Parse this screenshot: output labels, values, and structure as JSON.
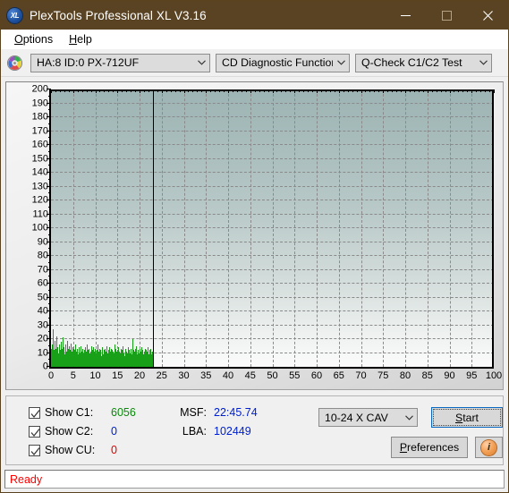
{
  "window": {
    "title": "PlexTools Professional XL V3.16",
    "app_icon": "xl-logo-icon",
    "icon_text": "XL",
    "minimize": "minimize-icon",
    "maximize": "maximize-icon",
    "close": "close-icon",
    "titlebar_color": "#5a4322"
  },
  "menubar": {
    "items": [
      {
        "label": "Options",
        "accel": "O"
      },
      {
        "label": "Help",
        "accel": "H"
      }
    ]
  },
  "toolbar": {
    "disc_icon": "compact-disc-icon",
    "device": {
      "value": "HA:8 ID:0  PX-712UF"
    },
    "function": {
      "value": "CD Diagnostic Functions"
    },
    "test": {
      "value": "Q-Check C1/C2 Test"
    }
  },
  "chart_data": {
    "type": "bar",
    "title": "",
    "xlabel": "",
    "ylabel": "",
    "xlim": [
      0,
      100
    ],
    "ylim": [
      0,
      200
    ],
    "xticks": [
      0,
      5,
      10,
      15,
      20,
      25,
      30,
      35,
      40,
      45,
      50,
      55,
      60,
      65,
      70,
      75,
      80,
      85,
      90,
      95,
      100
    ],
    "yticks": [
      0,
      10,
      20,
      30,
      40,
      50,
      60,
      70,
      80,
      90,
      100,
      110,
      120,
      130,
      140,
      150,
      160,
      170,
      180,
      190,
      200
    ],
    "grid": true,
    "legend": null,
    "series": [
      {
        "name": "C1",
        "color": "#19a019",
        "x_start": 0,
        "x_end": 23,
        "values": [
          13,
          8,
          11,
          16,
          9,
          27,
          7,
          12,
          10,
          6,
          19,
          8,
          13,
          7,
          22,
          9,
          5,
          11,
          14,
          7,
          10,
          16,
          8,
          6,
          12,
          9,
          18,
          7,
          11,
          5,
          13,
          8,
          21,
          10,
          6,
          14,
          9,
          7,
          12,
          16,
          8,
          11,
          6,
          19,
          9,
          7,
          13,
          10,
          5,
          15,
          8,
          12,
          7,
          17,
          9,
          6,
          11,
          14,
          8,
          10,
          5,
          13,
          7,
          9,
          12,
          6,
          16,
          8,
          11,
          7,
          10,
          13,
          5,
          9,
          14,
          7,
          12,
          6,
          10,
          8,
          15,
          9,
          7,
          11,
          5,
          13,
          8,
          10,
          6,
          12,
          9,
          7,
          14,
          8,
          11,
          5,
          10,
          16,
          7,
          9,
          12,
          6,
          13,
          8,
          10,
          7,
          11,
          5,
          15,
          9,
          8,
          12,
          6,
          10,
          14,
          7,
          9,
          11,
          5,
          13,
          8,
          10,
          7,
          12,
          6,
          16,
          9,
          8,
          11,
          7,
          10,
          5,
          13,
          9,
          12,
          6,
          8,
          14,
          7,
          11,
          9,
          5,
          10,
          12,
          8,
          7,
          13,
          6,
          9,
          11,
          15,
          8,
          10,
          7,
          12,
          5,
          9,
          14,
          8,
          11,
          6,
          10,
          7,
          13,
          9,
          8,
          12,
          5,
          11,
          7,
          10,
          16,
          9,
          6,
          13,
          8,
          11,
          7,
          10,
          12,
          5,
          9,
          14,
          8,
          7,
          11,
          6,
          10,
          13,
          9,
          8,
          12,
          7,
          5,
          11,
          15,
          9,
          10,
          6,
          8,
          13,
          7,
          12,
          9,
          11,
          5,
          10,
          8,
          14,
          7,
          9,
          6,
          12,
          10,
          8,
          11,
          13,
          7,
          9,
          5,
          20,
          10,
          8,
          12,
          6,
          11,
          9,
          7,
          13,
          10,
          8,
          15,
          9,
          6,
          11,
          7,
          12,
          10,
          8,
          5,
          13,
          9,
          11,
          7,
          10,
          6,
          14,
          8,
          12,
          9,
          7,
          11,
          5,
          10,
          13,
          8,
          9,
          12,
          6,
          7,
          11,
          10,
          8,
          14,
          9,
          5,
          12,
          7,
          10,
          6,
          13,
          9,
          8,
          11,
          7,
          10,
          12
        ]
      }
    ],
    "marker": {
      "name": "position-marker",
      "x": 23,
      "color": "#000000"
    },
    "plot_bg_top": "#9db4b4",
    "plot_bg_bottom": "#fbfbfb"
  },
  "info": {
    "checkboxes": [
      {
        "name": "show-c1",
        "label": "Show C1:",
        "checked": true,
        "value": "6056",
        "color": "#0a8a0a"
      },
      {
        "name": "show-c2",
        "label": "Show C2:",
        "checked": true,
        "value": "0",
        "color": "#0020cf"
      },
      {
        "name": "show-cu",
        "label": "Show CU:",
        "checked": true,
        "value": "0",
        "color": "#e00000"
      }
    ],
    "readouts": [
      {
        "key": "MSF:",
        "value": "22:45.74"
      },
      {
        "key": "LBA:",
        "value": "102449"
      }
    ],
    "speed": {
      "value": "10-24 X CAV"
    },
    "start_button": {
      "label": "Start",
      "accel": "S"
    },
    "preferences_button": {
      "label": "Preferences",
      "accel": "P"
    },
    "info_button": {
      "glyph": "i",
      "icon": "info-icon"
    }
  },
  "status": {
    "text": "Ready",
    "color": "#ff0000"
  }
}
